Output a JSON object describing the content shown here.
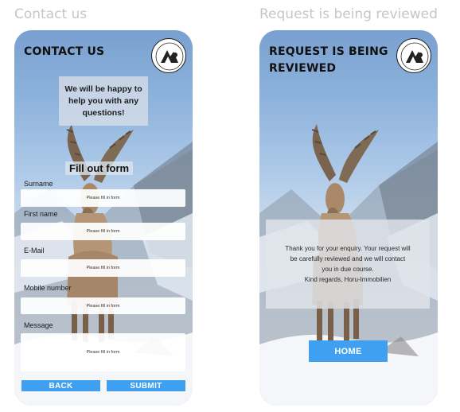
{
  "captions": {
    "contact": "Contact us",
    "review": "Request is being reviewed"
  },
  "contact_screen": {
    "title": "CONTACT US",
    "intro": "We will be happy to help you with any questions!",
    "form_heading": "Fill out form",
    "fields": [
      {
        "label": "Surname",
        "placeholder": "Please fill in form"
      },
      {
        "label": "First name",
        "placeholder": "Please fill in form"
      },
      {
        "label": "E-Mail",
        "placeholder": "Please fill in form"
      },
      {
        "label": "Mobile number",
        "placeholder": "Please fill in form"
      },
      {
        "label": "Message",
        "placeholder": "Please fill in form"
      }
    ],
    "back_label": "BACK",
    "submit_label": "SUBMIT"
  },
  "review_screen": {
    "title_line1": "REQUEST IS BEING",
    "title_line2": "REVIEWED",
    "message_line1": "Thank you for your enquiry. Your request will",
    "message_line2": "be carefully reviewed and we will contact",
    "message_line3": "you in due course.",
    "message_line4": "Kind regards, Horu-Immobilien",
    "home_label": "HOME"
  },
  "icons": {
    "logo": "company-logo-emblem",
    "photo": "alpine-ibex-photo"
  },
  "colors": {
    "accent": "#3f9ff0",
    "caption": "#c6c6c6"
  }
}
